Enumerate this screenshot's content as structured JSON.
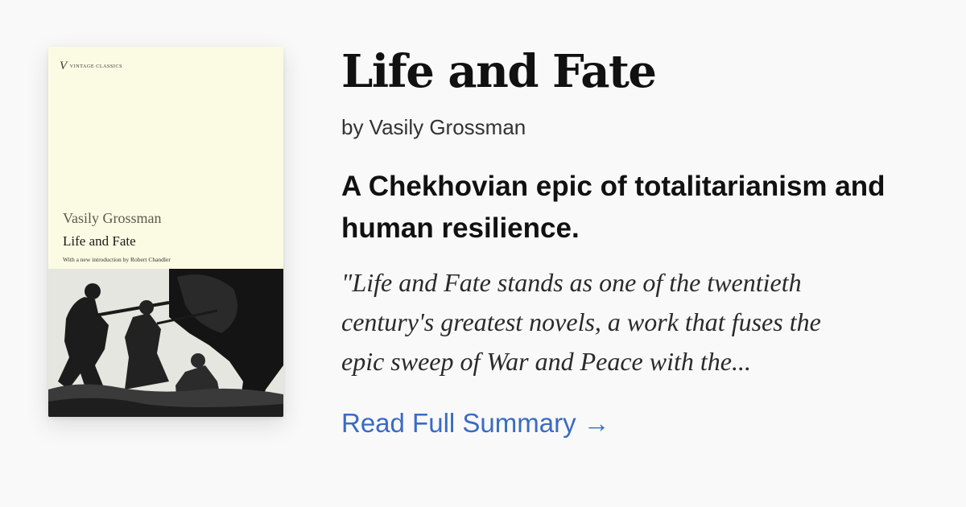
{
  "book": {
    "title": "Life and Fate",
    "byline": "by Vasily Grossman",
    "tagline": "A Chekhovian epic of totalitarianism and human resilience.",
    "quote_lines": [
      "\"Life and Fate stands as one of the twentieth",
      "century's greatest novels, a work that fuses the",
      "epic sweep of War and Peace with the..."
    ],
    "read_link": "Read Full Summary →"
  },
  "cover": {
    "series_mark": "V",
    "series": "VINTAGE CLASSICS",
    "author": "Vasily Grossman",
    "title": "Life and Fate",
    "intro": "With a new introduction by Robert Chandler",
    "image": "black-and-white photograph of soldiers charging with rifles"
  },
  "colors": {
    "background": "#f9f9f9",
    "cover_background": "#fbfbe3",
    "link": "#3a6bc4",
    "text": "#111111"
  }
}
